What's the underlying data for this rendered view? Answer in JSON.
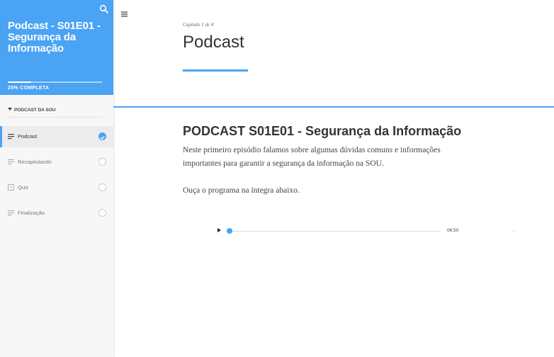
{
  "sidebar": {
    "course_title": "Podcast - S01E01 - Segurança da Informação",
    "progress_label": "25% COMPLETA",
    "progress_value": 0.25,
    "section_label": "PODCAST DA SOU",
    "lessons": [
      {
        "label": "Podcast",
        "icon": "text-lines-icon",
        "status": "complete",
        "active": true
      },
      {
        "label": "Recapitulando",
        "icon": "text-lines-icon",
        "status": "incomplete",
        "active": false
      },
      {
        "label": "Quiz",
        "icon": "quiz-icon",
        "status": "incomplete",
        "active": false
      },
      {
        "label": "Finalização",
        "icon": "text-lines-icon",
        "status": "incomplete",
        "active": false
      }
    ]
  },
  "main": {
    "chapter_label": "Capítulo 1 de 4",
    "page_title": "Podcast",
    "section_title": "PODCAST S01E01 - Segurança da Informação",
    "paragraph_1": "Neste primeiro episódio falamos sobre algumas dúvidas comuns e informações importantes para garantir a segurança da informação na SOU.",
    "paragraph_2": "Ouça o programa na íntegra abaixo.",
    "audio": {
      "duration": "06:50",
      "progress": 0
    }
  },
  "colors": {
    "accent": "#4aa3f3",
    "sidebar_bg": "#f7f7f7",
    "text_dark": "#333333"
  }
}
